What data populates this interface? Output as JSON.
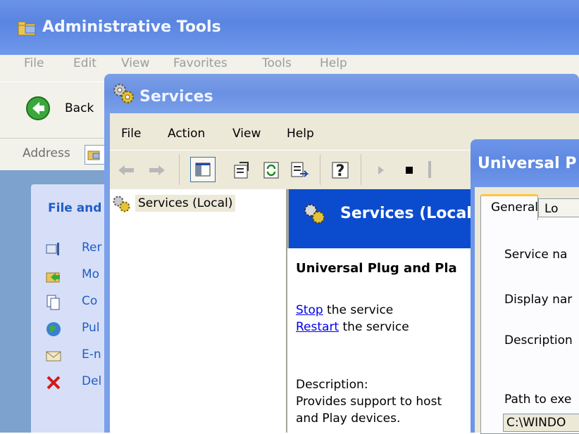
{
  "admin_window": {
    "title": "Administrative Tools",
    "menu": [
      "File",
      "Edit",
      "View",
      "Favorites",
      "Tools",
      "Help"
    ],
    "back_label": "Back",
    "address_label": "Address",
    "task_pane_title": "File and",
    "tasks": [
      "Rer",
      "Mo",
      "Co",
      "Pul",
      "E-n",
      "Del"
    ]
  },
  "services_window": {
    "title": "Services",
    "menu": [
      "File",
      "Action",
      "View",
      "Help"
    ],
    "tree_item": "Services (Local)",
    "detail_header": "Services (Local",
    "service_name": "Universal Plug and Pla",
    "stop_link": "Stop",
    "stop_suffix": " the service",
    "restart_link": "Restart",
    "restart_suffix": " the service",
    "description_label": "Description:",
    "description_line1": "Provides support to host",
    "description_line2": "and Play devices."
  },
  "properties_dialog": {
    "title": "Universal P",
    "tab_general": "General",
    "tab_logon": "Lo",
    "service_name_label": "Service na",
    "display_name_label": "Display nar",
    "description_label": "Description",
    "path_label": "Path to exe",
    "path_value": "C:\\WINDO"
  }
}
